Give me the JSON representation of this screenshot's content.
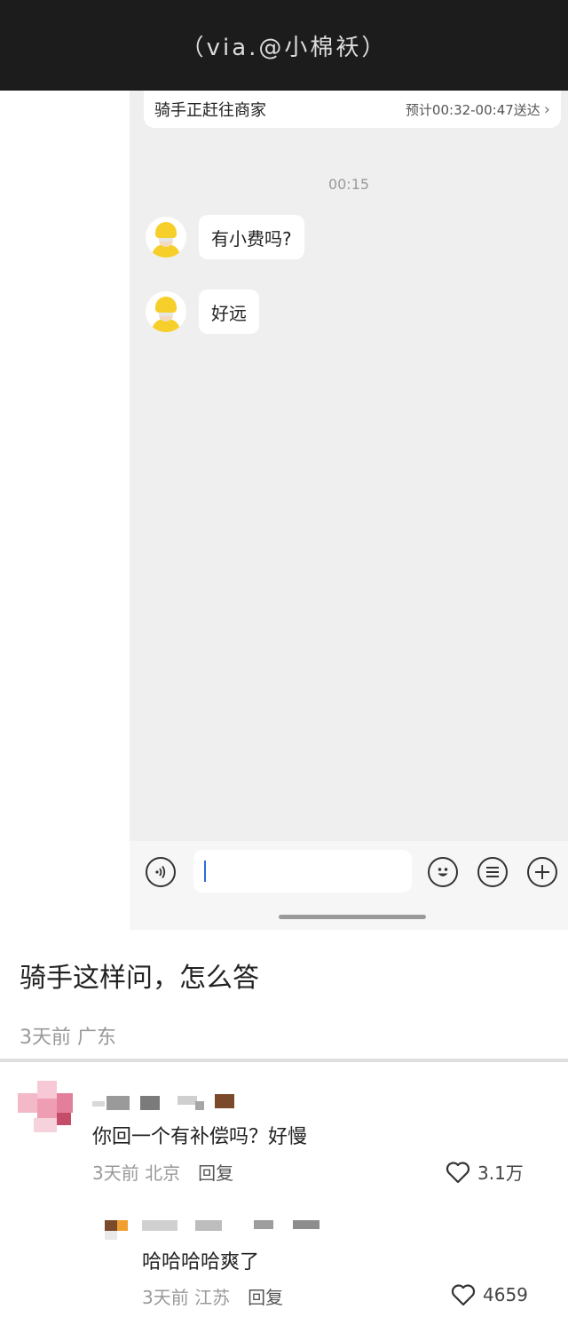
{
  "watermark": "（via.@小棉袄）",
  "chat": {
    "status_text": "骑手正赶往商家",
    "eta_text": "预计00:32-00:47送达",
    "timestamp": "00:15",
    "messages": [
      {
        "text": "有小费吗?"
      },
      {
        "text": "好远"
      }
    ]
  },
  "input_bar": {
    "voice_icon": "voice-icon",
    "emoji_icon": "emoji-icon",
    "menu_icon": "menu-icon",
    "add_icon": "plus-icon",
    "input_value": ""
  },
  "post": {
    "title": "骑手这样问，怎么答",
    "time": "3天前",
    "location": "广东"
  },
  "comments": [
    {
      "text": "你回一个有补偿吗？好慢",
      "time": "3天前",
      "location": "北京",
      "reply_label": "回复",
      "likes": "3.1万"
    },
    {
      "text": "哈哈哈哈爽了",
      "time": "3天前",
      "location": "江苏",
      "reply_label": "回复",
      "likes": "4659"
    }
  ],
  "colors": {
    "banner_bg": "#1c1c1c",
    "chat_bg": "#efefef",
    "helmet_yellow": "#f6cf2a",
    "meta_gray": "#999999"
  }
}
